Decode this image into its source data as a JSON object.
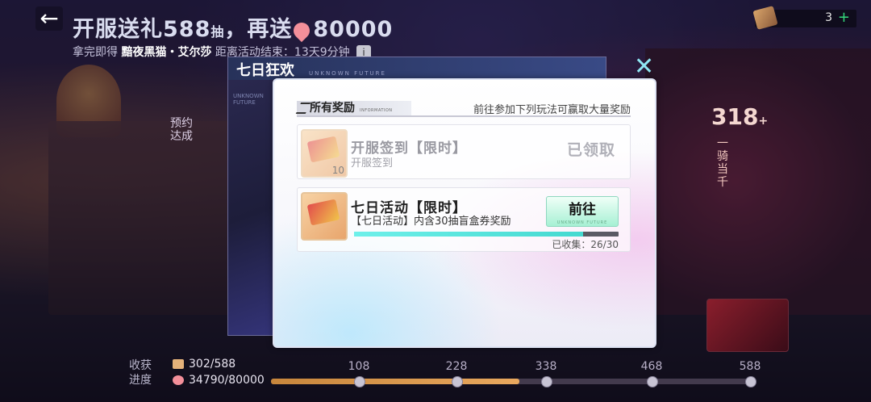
{
  "header": {
    "title_part1": "开服送礼",
    "title_num": "588",
    "title_unit": "抽",
    "title_part2": "再送",
    "title_num2": "80000",
    "sub_prefix": "拿完即得",
    "sub_character": "黯夜黑猫・艾尔莎",
    "sub_countdown": "距离活动结束：13天9分钟",
    "info_icon": "i"
  },
  "ticket": {
    "count": "3",
    "plus": "+"
  },
  "side": {
    "number": "318",
    "suffix": "+",
    "vertical": "一骑当千"
  },
  "reserve_text": "预约达成",
  "progress": {
    "label": "收获进度",
    "ticket_value": "302/588",
    "gem_value": "34790/80000",
    "milestones": [
      "108",
      "228",
      "338",
      "468",
      "588"
    ],
    "fill_fraction": 0.514
  },
  "back_panel": {
    "title": "七日狂欢",
    "brand": "UNKNOWN FUTURE"
  },
  "card": {
    "section_title": "所有奖励",
    "section_en": "INFORMATION",
    "section_right": "前往参加下列玩法可赢取大量奖励",
    "rows": [
      {
        "title": "开服签到【限时】",
        "desc": "开服签到",
        "qty": "10",
        "status": "已领取"
      },
      {
        "title": "七日活动【限时】",
        "desc": "【七日活动】内含30抽盲盒券奖励",
        "button": "前往",
        "button_en": "UNKNOWN FUTURE",
        "collect": "已收集：26/30",
        "progress": 0.867
      }
    ]
  }
}
